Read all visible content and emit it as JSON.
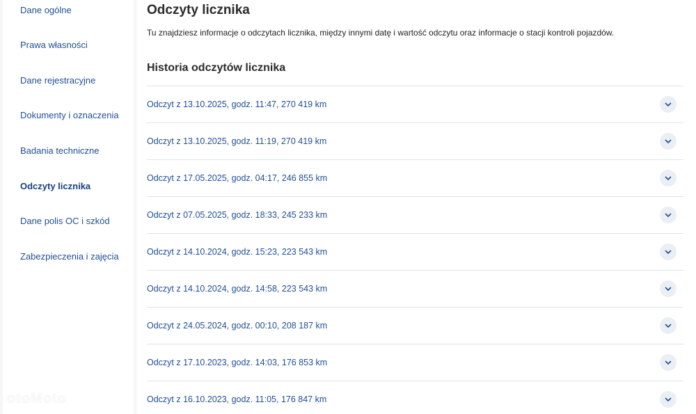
{
  "sidebar": {
    "items": [
      {
        "label": "Dane ogólne"
      },
      {
        "label": "Prawa własności"
      },
      {
        "label": "Dane rejestracyjne"
      },
      {
        "label": "Dokumenty i oznaczenia"
      },
      {
        "label": "Badania techniczne"
      },
      {
        "label": "Odczyty licznika",
        "active": true
      },
      {
        "label": "Dane polis OC i szkód"
      },
      {
        "label": "Zabezpieczenia i zajęcia"
      }
    ]
  },
  "main": {
    "title": "Odczyty licznika",
    "intro": "Tu znajdziesz informacje o odczytach licznika, między innymi datę i wartość odczytu oraz informacje o stacji kontroli pojazdów.",
    "history_title": "Historia odczytów licznika",
    "readings": [
      {
        "label": "Odczyt z 13.10.2025, godz. 11:47, 270 419 km"
      },
      {
        "label": "Odczyt z 13.10.2025, godz. 11:19, 270 419 km"
      },
      {
        "label": "Odczyt z 17.05.2025, godz. 04:17, 246 855 km"
      },
      {
        "label": "Odczyt z 07.05.2025, godz. 18:33, 245 233 km"
      },
      {
        "label": "Odczyt z 14.10.2024, godz. 15:23, 223 543 km"
      },
      {
        "label": "Odczyt z 14.10.2024, godz. 14:58, 223 543 km"
      },
      {
        "label": "Odczyt z 24.05.2024, godz. 00:10, 208 187 km"
      },
      {
        "label": "Odczyt z 17.10.2023, godz. 14:03, 176 853 km"
      },
      {
        "label": "Odczyt z 16.10.2023, godz. 11:05, 176 847 km"
      }
    ]
  },
  "watermark": "otoMoto",
  "colors": {
    "link": "#1f4f96",
    "divider": "#dde3ea",
    "chevron_bg": "#eaeff5"
  },
  "icons": {
    "expand": "chevron-down-icon"
  }
}
